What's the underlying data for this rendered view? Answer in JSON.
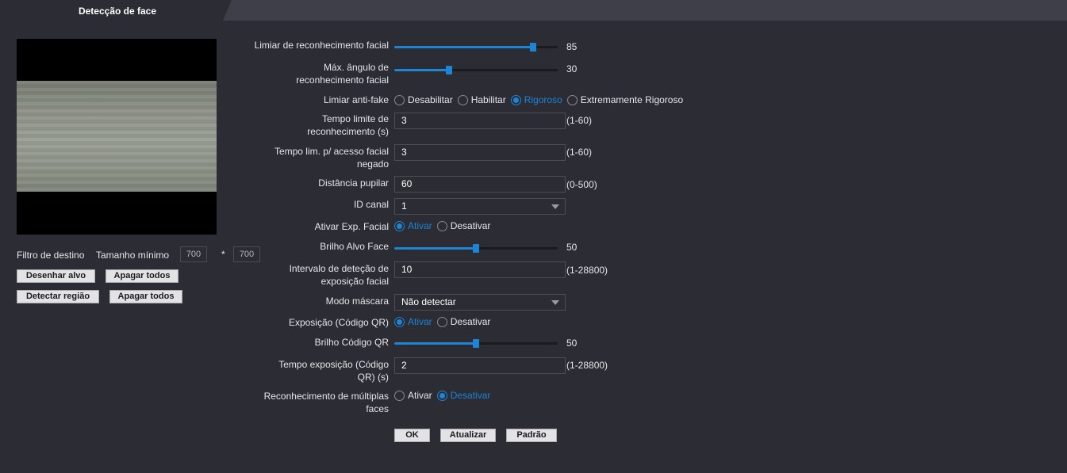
{
  "tab": {
    "label": "Detecção de face"
  },
  "left": {
    "target_filter_label": "Filtro de destino",
    "min_size_label": "Tamanho mínimo",
    "min_width": "700",
    "separator": "*",
    "min_height": "700",
    "draw_target_btn": "Desenhar alvo",
    "clear_all_btn_1": "Apagar todos",
    "detect_region_btn": "Detectar região",
    "clear_all_btn_2": "Apagar todos"
  },
  "form": {
    "recognition_threshold": {
      "label": "Limiar de reconhecimento facial",
      "value": 85,
      "max": 100
    },
    "max_angle": {
      "label": "Máx. ângulo de reconhecimento facial",
      "value": 30,
      "max": 90
    },
    "anti_fake": {
      "label": "Limiar anti-fake",
      "options": [
        "Desabilitar",
        "Habilitar",
        "Rigoroso",
        "Extremamente Rigoroso"
      ],
      "selected": "Rigoroso"
    },
    "recognition_timeout": {
      "label": "Tempo limite de reconhecimento (s)",
      "value": "3",
      "range": "(1-60)"
    },
    "denied_timeout": {
      "label": "Tempo lim. p/ acesso facial negado",
      "value": "3",
      "range": "(1-60)"
    },
    "pupil_distance": {
      "label": "Distância pupilar",
      "value": "60",
      "range": "(0-500)"
    },
    "channel_id": {
      "label": "ID canal",
      "value": "1"
    },
    "face_exposure": {
      "label": "Ativar Exp. Facial",
      "options": [
        "Ativar",
        "Desativar"
      ],
      "selected": "Ativar"
    },
    "face_brightness": {
      "label": "Brilho Alvo Face",
      "value": 50,
      "max": 100
    },
    "exposure_interval": {
      "label": "Intervalo de deteção de exposição facial",
      "value": "10",
      "range": "(1-28800)"
    },
    "mask_mode": {
      "label": "Modo máscara",
      "value": "Não detectar"
    },
    "qr_exposure": {
      "label": "Exposição (Código QR)",
      "options": [
        "Ativar",
        "Desativar"
      ],
      "selected": "Ativar"
    },
    "qr_brightness": {
      "label": "Brilho Código QR",
      "value": 50,
      "max": 100
    },
    "qr_exposure_time": {
      "label": "Tempo exposição (Código QR) (s)",
      "value": "2",
      "range": "(1-28800)"
    },
    "multi_face": {
      "label": "Reconhecimento de múltiplas faces",
      "options": [
        "Ativar",
        "Desativar"
      ],
      "selected": "Desativar"
    }
  },
  "buttons": {
    "ok": "OK",
    "refresh": "Atualizar",
    "default": "Padrão"
  },
  "colors": {
    "accent": "#1d84d6",
    "background": "#2b2c34",
    "topbar": "#3e3f48"
  }
}
